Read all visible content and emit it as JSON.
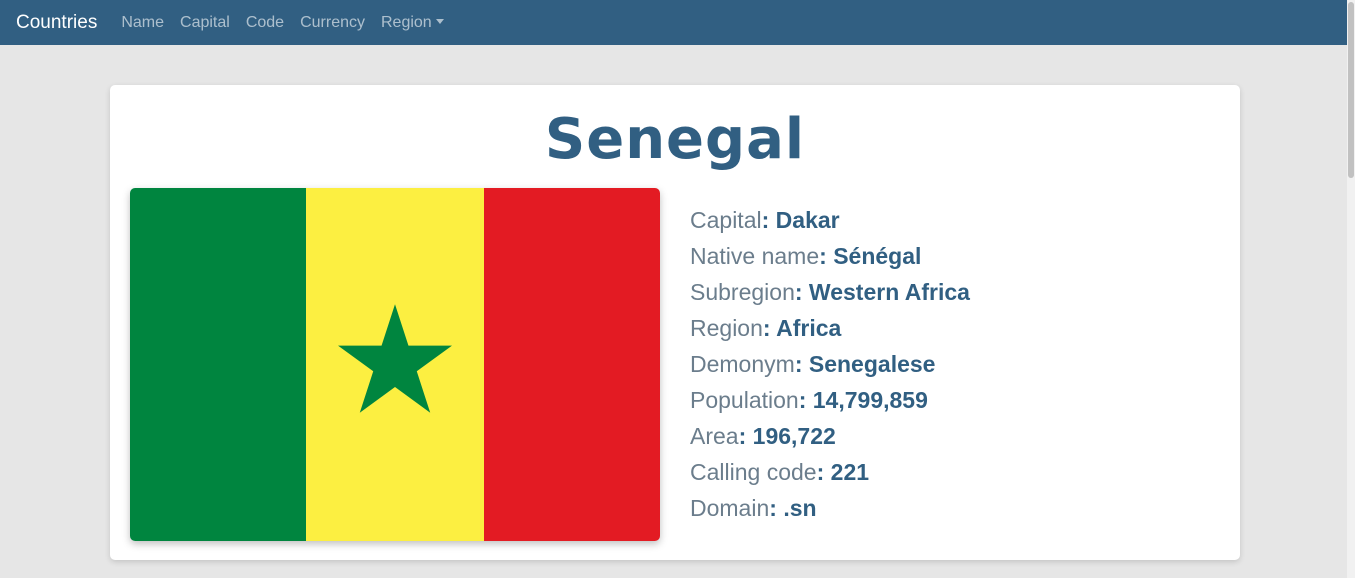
{
  "navbar": {
    "brand": "Countries",
    "links": [
      "Name",
      "Capital",
      "Code",
      "Currency",
      "Region"
    ]
  },
  "country": {
    "name": "Senegal",
    "flag": {
      "colors": [
        "#00853f",
        "#fcef41",
        "#e31b23"
      ],
      "star_color": "#00853f",
      "icon": "star-icon"
    },
    "details": [
      {
        "label": "Capital",
        "value": "Dakar"
      },
      {
        "label": "Native name",
        "value": "Sénégal"
      },
      {
        "label": "Subregion",
        "value": "Western Africa"
      },
      {
        "label": "Region",
        "value": "Africa"
      },
      {
        "label": "Demonym",
        "value": "Senegalese"
      },
      {
        "label": "Population",
        "value": "14,799,859"
      },
      {
        "label": "Area",
        "value": "196,722"
      },
      {
        "label": "Calling code",
        "value": "221"
      },
      {
        "label": "Domain",
        "value": ".sn"
      }
    ]
  },
  "colors": {
    "navbar_bg": "#315f82",
    "accent": "#315f82",
    "page_bg": "#e6e6e6"
  }
}
